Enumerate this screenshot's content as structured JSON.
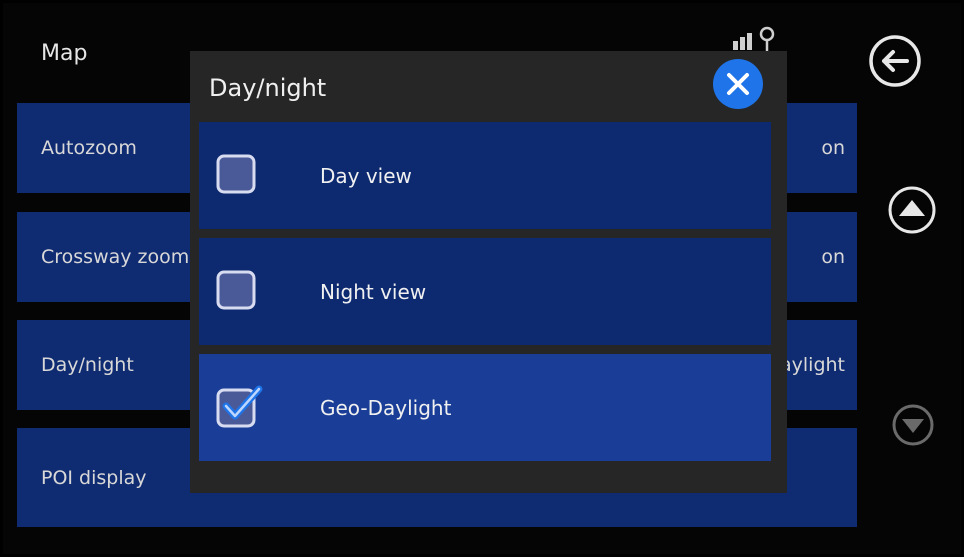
{
  "page": {
    "title": "Map"
  },
  "settings": [
    {
      "label": "Autozoom",
      "value": "on"
    },
    {
      "label": "Crossway zoom",
      "value": "on"
    },
    {
      "label": "Day/night",
      "value": "Geo-Daylight"
    },
    {
      "label": "POI display",
      "value": ""
    }
  ],
  "dialog": {
    "title": "Day/night",
    "options": [
      {
        "label": "Day view",
        "checked": false
      },
      {
        "label": "Night view",
        "checked": false
      },
      {
        "label": "Geo-Daylight",
        "checked": true
      }
    ]
  },
  "icons": {
    "back": "back-arrow-icon",
    "close": "close-icon",
    "scroll_up": "triangle-up-icon",
    "scroll_down": "triangle-down-icon",
    "top": "gps-signal-icon"
  },
  "colors": {
    "accent": "#1e74e8",
    "row": "#0f2b71",
    "row_selected": "#1a3e97",
    "dialog_bg": "#262626"
  }
}
